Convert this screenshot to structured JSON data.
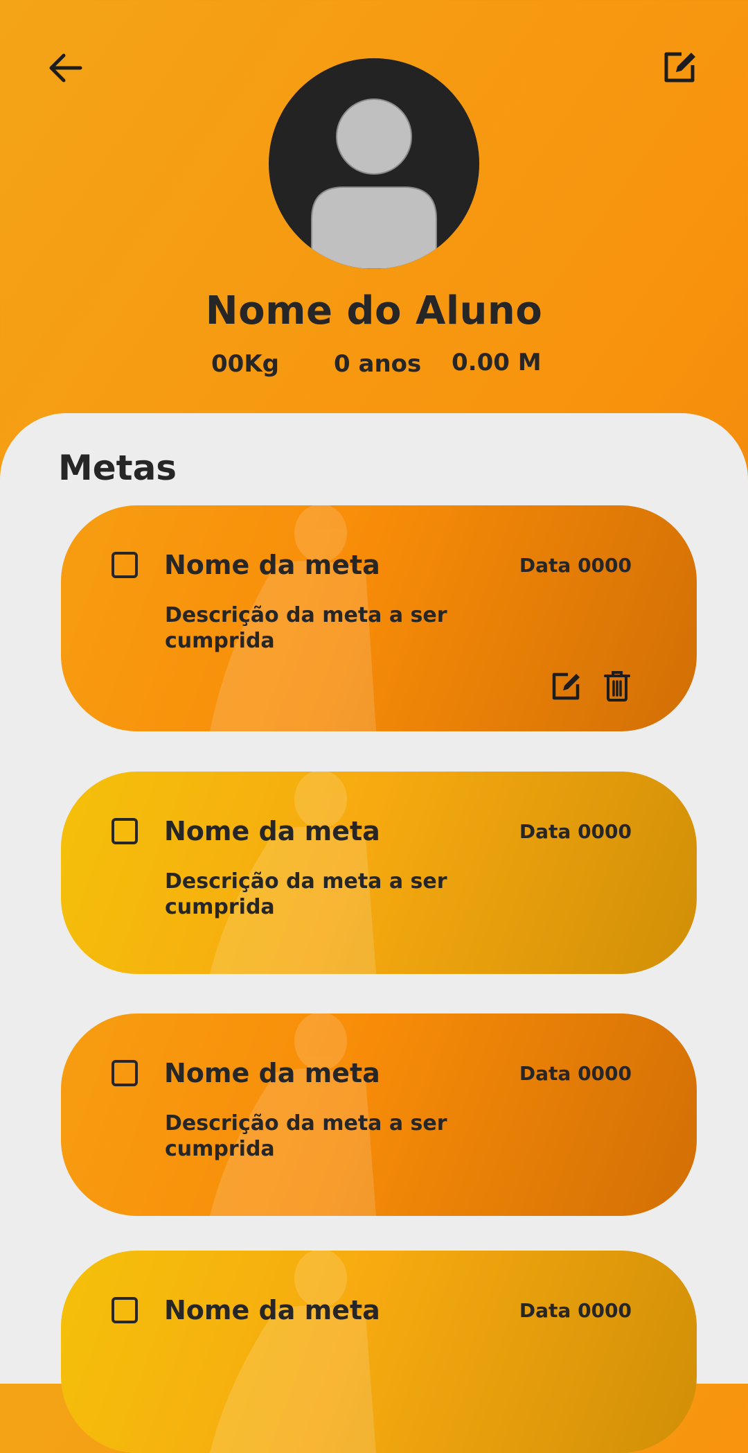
{
  "header": {
    "back_icon": "arrow-left-icon",
    "edit_icon": "edit-square-icon",
    "avatar_icon": "user-silhouette-icon",
    "student_name": "Nome do Aluno",
    "weight": "00Kg",
    "age": "0 anos",
    "height": "0.00 M"
  },
  "colors": {
    "accent_orange": "#f8920d",
    "accent_yellow": "#f4c00a",
    "panel_background": "#ededed",
    "text_dark": "#262626"
  },
  "goals": {
    "title": "Metas",
    "items": [
      {
        "name": "Nome da meta",
        "date": "Data 0000",
        "description": "Descrição da meta a ser cumprida",
        "checked": false,
        "color": "orange",
        "actions": [
          "edit-icon",
          "trash-icon"
        ]
      },
      {
        "name": "Nome da meta",
        "date": "Data 0000",
        "description": "Descrição da meta a ser cumprida",
        "checked": false,
        "color": "yellow"
      },
      {
        "name": "Nome da meta",
        "date": "Data 0000",
        "description": "Descrição da meta a ser cumprida",
        "checked": false,
        "color": "orange"
      },
      {
        "name": "Nome da meta",
        "date": "Data 0000",
        "description": "",
        "checked": false,
        "color": "yellow"
      }
    ]
  }
}
